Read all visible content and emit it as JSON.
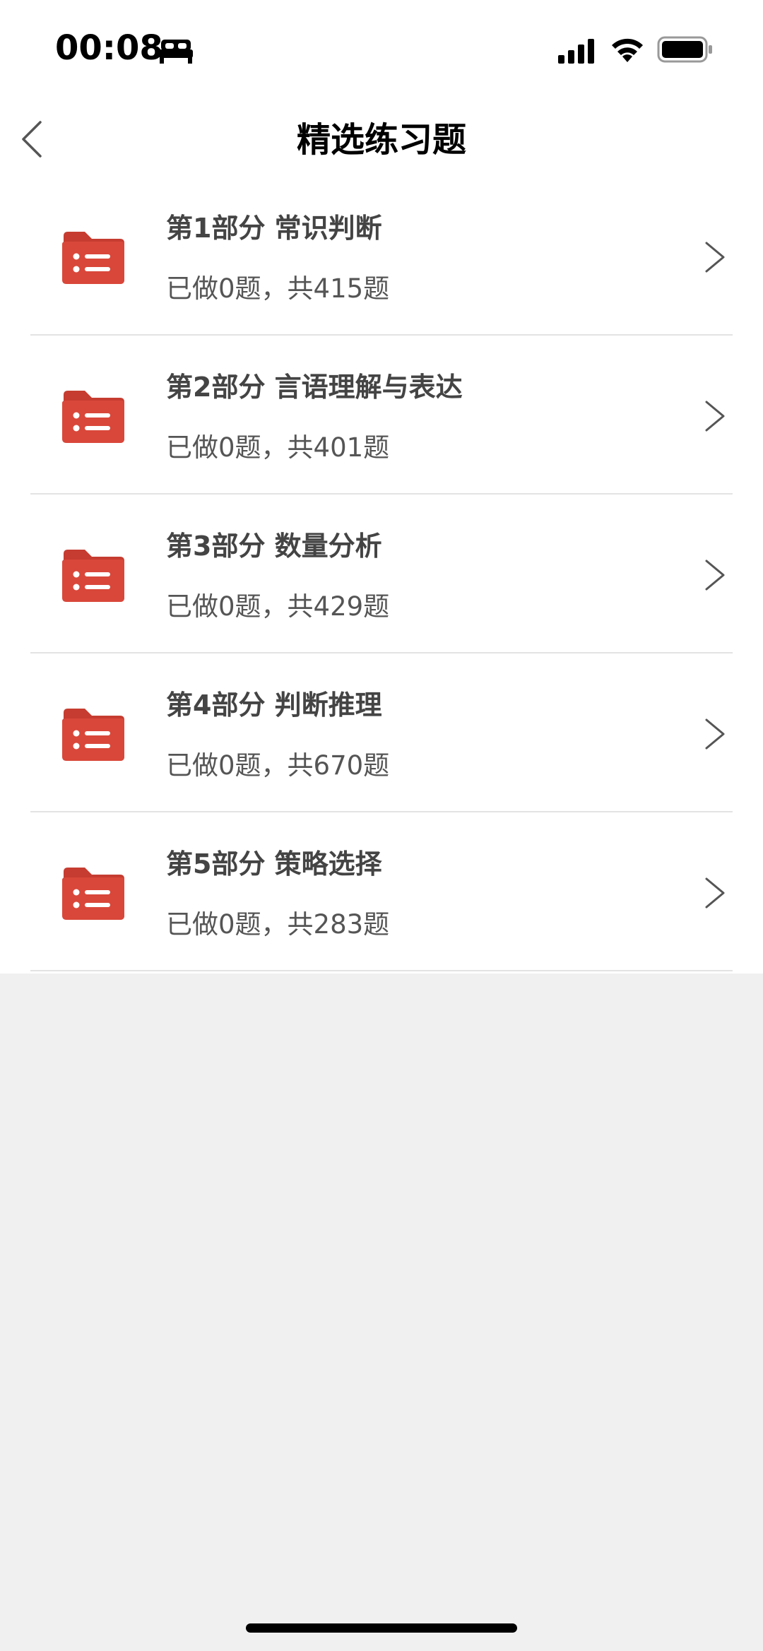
{
  "status_bar": {
    "time": "00:08"
  },
  "nav": {
    "title": "精选练习题"
  },
  "sections": [
    {
      "title": "第1部分 常识判断",
      "progress": "已做0题，共415题"
    },
    {
      "title": "第2部分 言语理解与表达",
      "progress": "已做0题，共401题"
    },
    {
      "title": "第3部分 数量分析",
      "progress": "已做0题，共429题"
    },
    {
      "title": "第4部分 判断推理",
      "progress": "已做0题，共670题"
    },
    {
      "title": "第5部分 策略选择",
      "progress": "已做0题，共283题"
    }
  ],
  "colors": {
    "folder": "#d9473a",
    "folder_dark": "#c63c30",
    "lower_background": "#f0f0f0"
  },
  "icons": [
    "bed-icon",
    "cellular-signal-icon",
    "wifi-icon",
    "battery-icon",
    "back-chevron-icon",
    "folder-list-icon",
    "chevron-right-icon"
  ]
}
